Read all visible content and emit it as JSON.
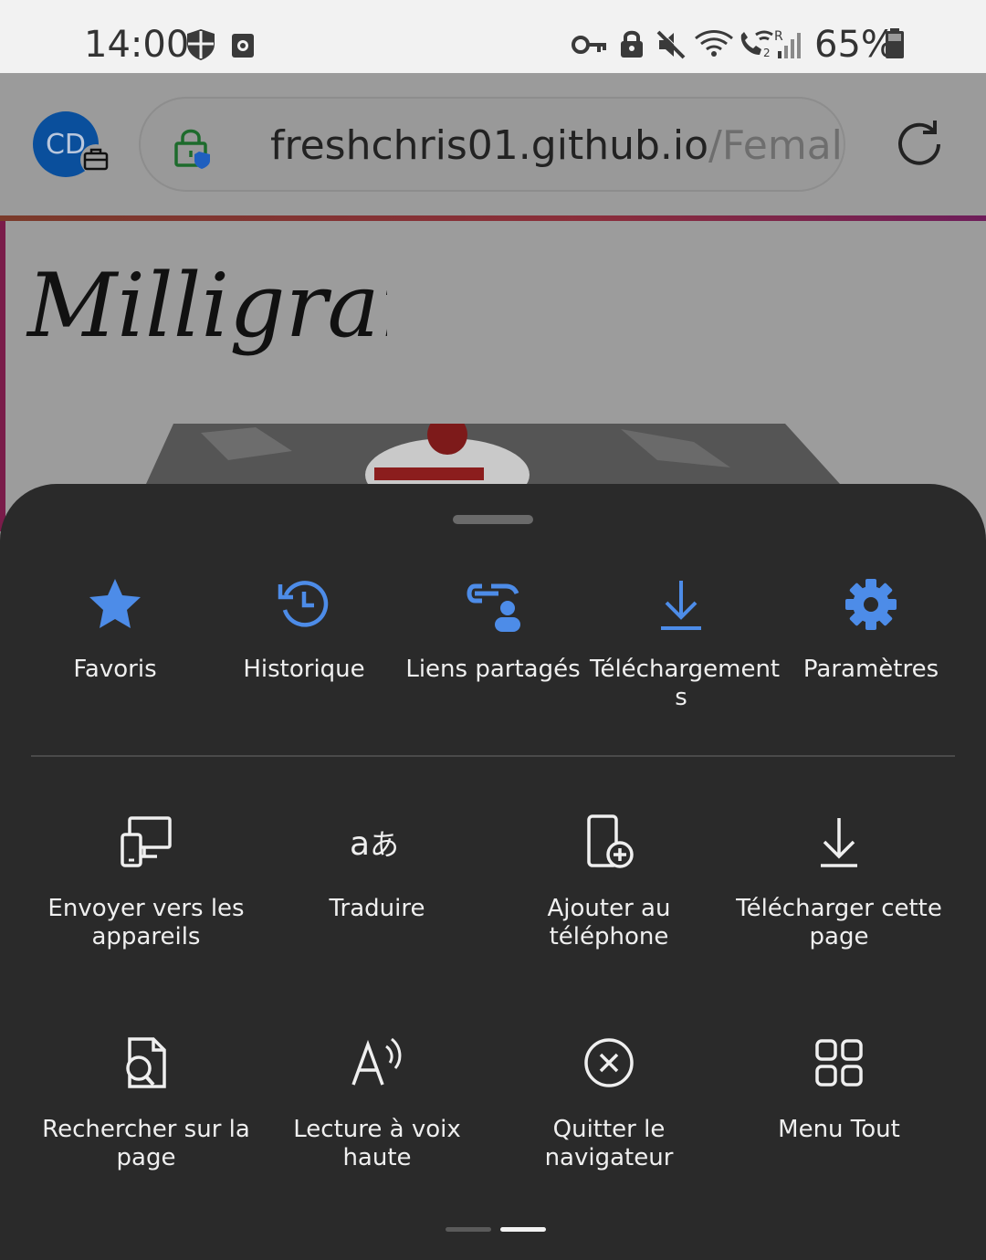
{
  "status_bar": {
    "time": "14:00",
    "battery": "65%",
    "icons": [
      "shield-icon",
      "screen-record-icon",
      "vpn-key-icon",
      "lock-icon",
      "mute-icon",
      "wifi-icon",
      "wifi-call-icon",
      "signal-icon",
      "battery-icon"
    ]
  },
  "browser": {
    "profile_initials": "CD",
    "url_host": "freshchris01.github.io",
    "url_path": "/Female",
    "lock_icon": "secure-lock-icon",
    "reload_icon": "reload-icon"
  },
  "page": {
    "logo_text": "Milligram"
  },
  "menu": {
    "top_row": [
      {
        "label": "Favoris",
        "icon": "star-icon"
      },
      {
        "label": "Historique",
        "icon": "history-icon"
      },
      {
        "label": "Liens partagés",
        "icon": "shared-links-icon"
      },
      {
        "label": "Téléchargement\ns",
        "icon": "download-icon"
      },
      {
        "label": "Paramètres",
        "icon": "gear-icon"
      }
    ],
    "grid": [
      {
        "label": "Envoyer vers les appareils",
        "icon": "send-to-devices-icon"
      },
      {
        "label": "Traduire",
        "icon": "translate-icon"
      },
      {
        "label": "Ajouter au téléphone",
        "icon": "add-to-phone-icon"
      },
      {
        "label": "Télécharger cette page",
        "icon": "download-page-icon"
      },
      {
        "label": "Rechercher sur la page",
        "icon": "find-in-page-icon"
      },
      {
        "label": "Lecture à voix haute",
        "icon": "read-aloud-icon"
      },
      {
        "label": "Quitter le navigateur",
        "icon": "close-circle-icon"
      },
      {
        "label": "Menu Tout",
        "icon": "all-menu-icon"
      }
    ],
    "pager": {
      "pages": 2,
      "current": 2
    }
  },
  "colors": {
    "accent_blue": "#4d8ce8",
    "sheet_bg": "#2a2a2a",
    "label_text": "#efefef"
  }
}
